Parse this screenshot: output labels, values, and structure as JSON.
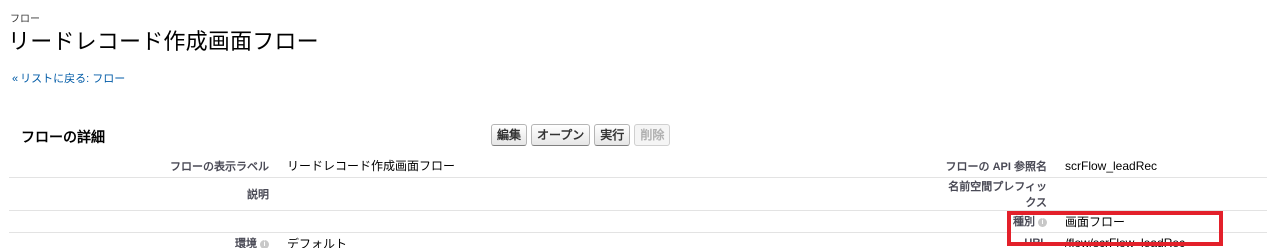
{
  "header": {
    "page_type": "フロー",
    "title": "リードレコード作成画面フロー",
    "back_link": "リストに戻る: フロー",
    "back_chevron": "«"
  },
  "section": {
    "title": "フローの詳細"
  },
  "buttons": {
    "edit": "編集",
    "open": "オープン",
    "run": "実行",
    "delete": "削除"
  },
  "details": {
    "display_label": {
      "label": "フローの表示ラベル",
      "value": "リードレコード作成画面フロー"
    },
    "api_name": {
      "label": "フローの API 参照名",
      "value": "scrFlow_leadRec"
    },
    "description": {
      "label": "説明",
      "value": ""
    },
    "namespace_prefix": {
      "label": "名前空間プレフィックス",
      "value": ""
    },
    "type": {
      "label": "種別",
      "value": "画面フロー"
    },
    "environment": {
      "label": "環境",
      "value": "デフォルト"
    },
    "url": {
      "label": "URL",
      "value": "/flow/scrFlow_leadRec"
    }
  },
  "help_icon_glyph": "i",
  "colors": {
    "highlight": "#e3202a",
    "link": "#015ba7"
  }
}
